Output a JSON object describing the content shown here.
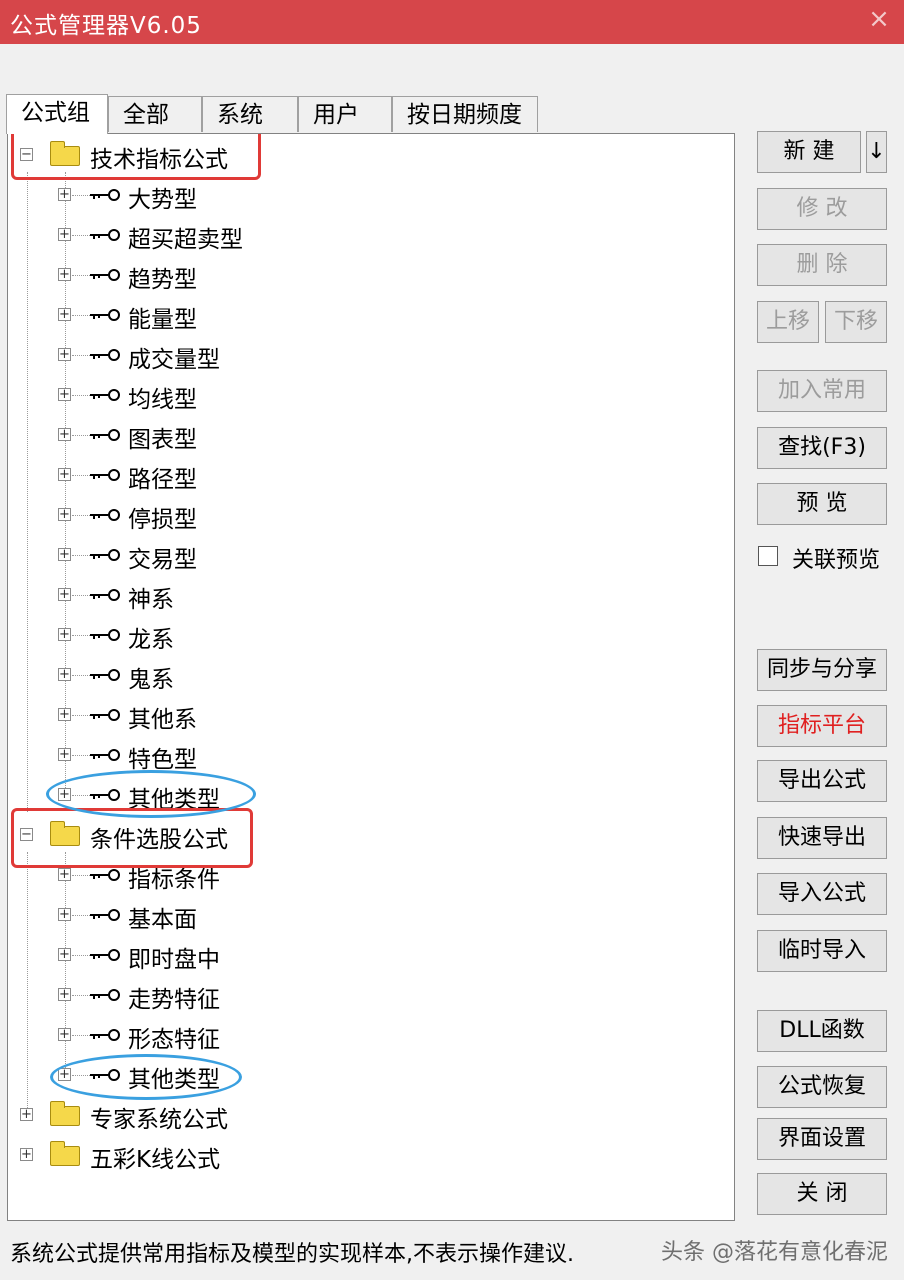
{
  "window": {
    "title": "公式管理器V6.05",
    "close_glyph": "×"
  },
  "tabs": [
    {
      "label": "公式组",
      "active": true
    },
    {
      "label": "全部",
      "active": false
    },
    {
      "label": "系统",
      "active": false
    },
    {
      "label": "用户",
      "active": false
    },
    {
      "label": "按日期频度",
      "active": false
    }
  ],
  "tree": {
    "group1": {
      "label": "技术指标公式",
      "expander": "−",
      "items": [
        "大势型",
        "超买超卖型",
        "趋势型",
        "能量型",
        "成交量型",
        "均线型",
        "图表型",
        "路径型",
        "停损型",
        "交易型",
        "神系",
        "龙系",
        "鬼系",
        "其他系",
        "特色型",
        "其他类型"
      ]
    },
    "group2": {
      "label": "条件选股公式",
      "expander": "−",
      "items": [
        "指标条件",
        "基本面",
        "即时盘中",
        "走势特征",
        "形态特征",
        "其他类型"
      ]
    },
    "group3": {
      "label": "专家系统公式",
      "expander": "+"
    },
    "group4": {
      "label": "五彩K线公式",
      "expander": "+"
    },
    "item_expander": "+",
    "icons": {
      "folder": "folder-icon",
      "formula": "key-icon"
    }
  },
  "buttons": {
    "new": "新 建",
    "new_arrow": "↓",
    "modify": "修 改",
    "delete": "删 除",
    "move_up": "上移",
    "move_down": "下移",
    "add_common": "加入常用",
    "find": "查找(F3)",
    "preview": "预 览",
    "sync_share": "同步与分享",
    "indicator_platform": "指标平台",
    "export_formula": "导出公式",
    "quick_export": "快速导出",
    "import_formula": "导入公式",
    "temp_import": "临时导入",
    "dll_function": "DLL函数",
    "formula_restore": "公式恢复",
    "ui_settings": "界面设置",
    "close": "关 闭"
  },
  "checkbox": {
    "label": "关联预览",
    "checked": false
  },
  "status": {
    "text": "系统公式提供常用指标及模型的实现样本,不表示操作建议."
  },
  "watermark": {
    "text": "头条 @落花有意化春泥"
  },
  "colors": {
    "titlebar": "#d6464a",
    "annotation_red": "#e03a37",
    "annotation_blue": "#3aa0e0",
    "platform_text": "#e02020"
  }
}
